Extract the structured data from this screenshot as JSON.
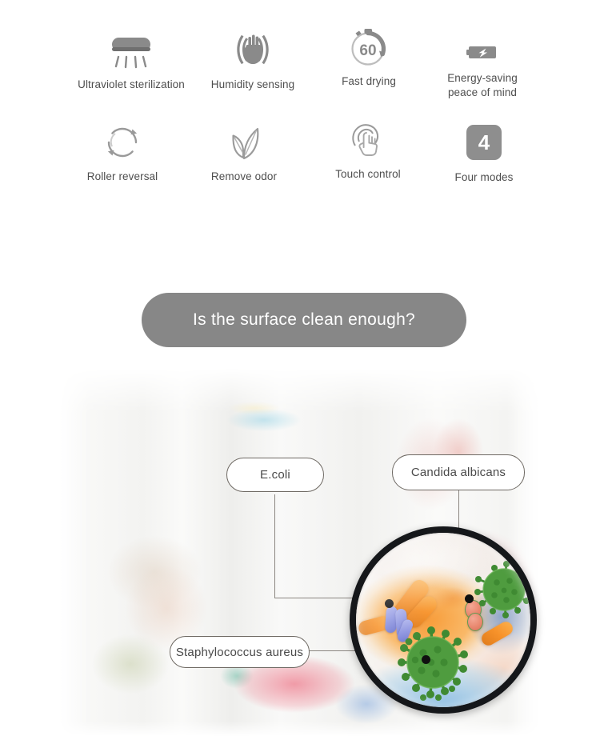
{
  "features": {
    "row1": [
      {
        "label": "Ultraviolet sterilization",
        "icon": "uv-lamp-icon"
      },
      {
        "label": "Humidity sensing",
        "icon": "hand-humidity-icon"
      },
      {
        "label": "Fast drying",
        "icon": "timer-60-icon",
        "badge": "60"
      },
      {
        "label": "Energy-saving\npeace of mind",
        "line1": "Energy-saving",
        "line2": "peace of mind",
        "icon": "battery-bolt-icon"
      }
    ],
    "row2": [
      {
        "label": "Roller reversal",
        "icon": "circular-arrows-icon"
      },
      {
        "label": "Remove odor",
        "icon": "leaves-icon"
      },
      {
        "label": "Touch control",
        "icon": "touch-finger-icon"
      },
      {
        "label": "Four modes",
        "icon": "four-modes-badge",
        "badge": "4"
      }
    ]
  },
  "banner": {
    "question": "Is the surface clean enough?"
  },
  "germs": {
    "callouts": [
      {
        "name": "E.coli"
      },
      {
        "name": "Candida albicans"
      },
      {
        "name": "Staphylococcus aureus"
      }
    ]
  },
  "colors": {
    "icon_gray": "#8e8e8e",
    "label_gray": "#4e4e4e",
    "banner_gray": "#878787",
    "banner_text": "#ffffff",
    "pill_border": "#6e6963",
    "leader_line": "#8b8681",
    "lens_rim": "#15171a",
    "germ_green": "#4f9c3f",
    "ecoli_blue": "#8c93e0",
    "candida_salmon": "#e8866d",
    "towel_orange": "#f7922a"
  }
}
